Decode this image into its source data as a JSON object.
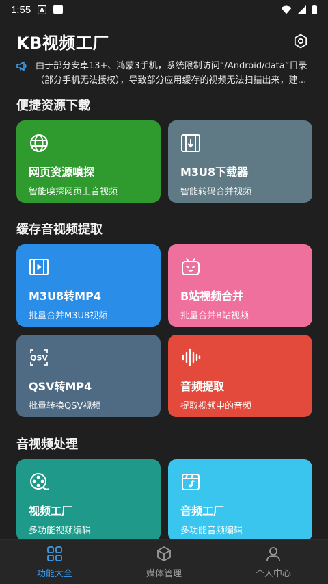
{
  "status_bar": {
    "time": "1:55",
    "icons": [
      "notification-a-icon",
      "square-icon",
      "wifi-icon",
      "signal-icon",
      "battery-icon"
    ]
  },
  "header": {
    "title": "KB视频工厂",
    "settings_icon": "settings-hexagon-icon"
  },
  "notice": {
    "icon": "megaphone-icon",
    "text": "由于部分安卓13+、鸿蒙3手机，系统限制访问“/Android/data”目录（部分手机无法授权），导致部分应用缓存的视频无法扫描出来，建议使用其他方式"
  },
  "sections": [
    {
      "title": "便捷资源下载",
      "cards": [
        {
          "icon": "globe-icon",
          "title": "网页资源嗅探",
          "subtitle": "智能嗅探网页上音视频",
          "color": "#2f9a2d"
        },
        {
          "icon": "download-film-icon",
          "title": "M3U8下载器",
          "subtitle": "智能转码合并视频",
          "color": "#5f7a84"
        }
      ]
    },
    {
      "title": "缓存音视频提取",
      "cards": [
        {
          "icon": "video-file-icon",
          "title": "M3U8转MP4",
          "subtitle": "批量合并M3U8视频",
          "color": "#2a8de8"
        },
        {
          "icon": "bilibili-tv-icon",
          "title": "B站视频合并",
          "subtitle": "批量合并B站视频",
          "color": "#f0709d"
        },
        {
          "icon": "qsv-icon",
          "title": "QSV转MP4",
          "subtitle": "批量转换QSV视频",
          "color": "#4f6b84"
        },
        {
          "icon": "sound-wave-icon",
          "title": "音频提取",
          "subtitle": "提取视频中的音频",
          "color": "#e34a3c"
        }
      ]
    },
    {
      "title": "音视频处理",
      "cards": [
        {
          "icon": "film-reel-icon",
          "title": "视频工厂",
          "subtitle": "多功能视频编辑",
          "color": "#1f9a8a"
        },
        {
          "icon": "music-clapper-icon",
          "title": "音频工厂",
          "subtitle": "多功能音频编辑",
          "color": "#3ac5ef"
        }
      ]
    }
  ],
  "bottom_nav": [
    {
      "icon": "grid-icon",
      "label": "功能大全",
      "active": true
    },
    {
      "icon": "cube-icon",
      "label": "媒体管理",
      "active": false
    },
    {
      "icon": "person-icon",
      "label": "个人中心",
      "active": false
    }
  ]
}
